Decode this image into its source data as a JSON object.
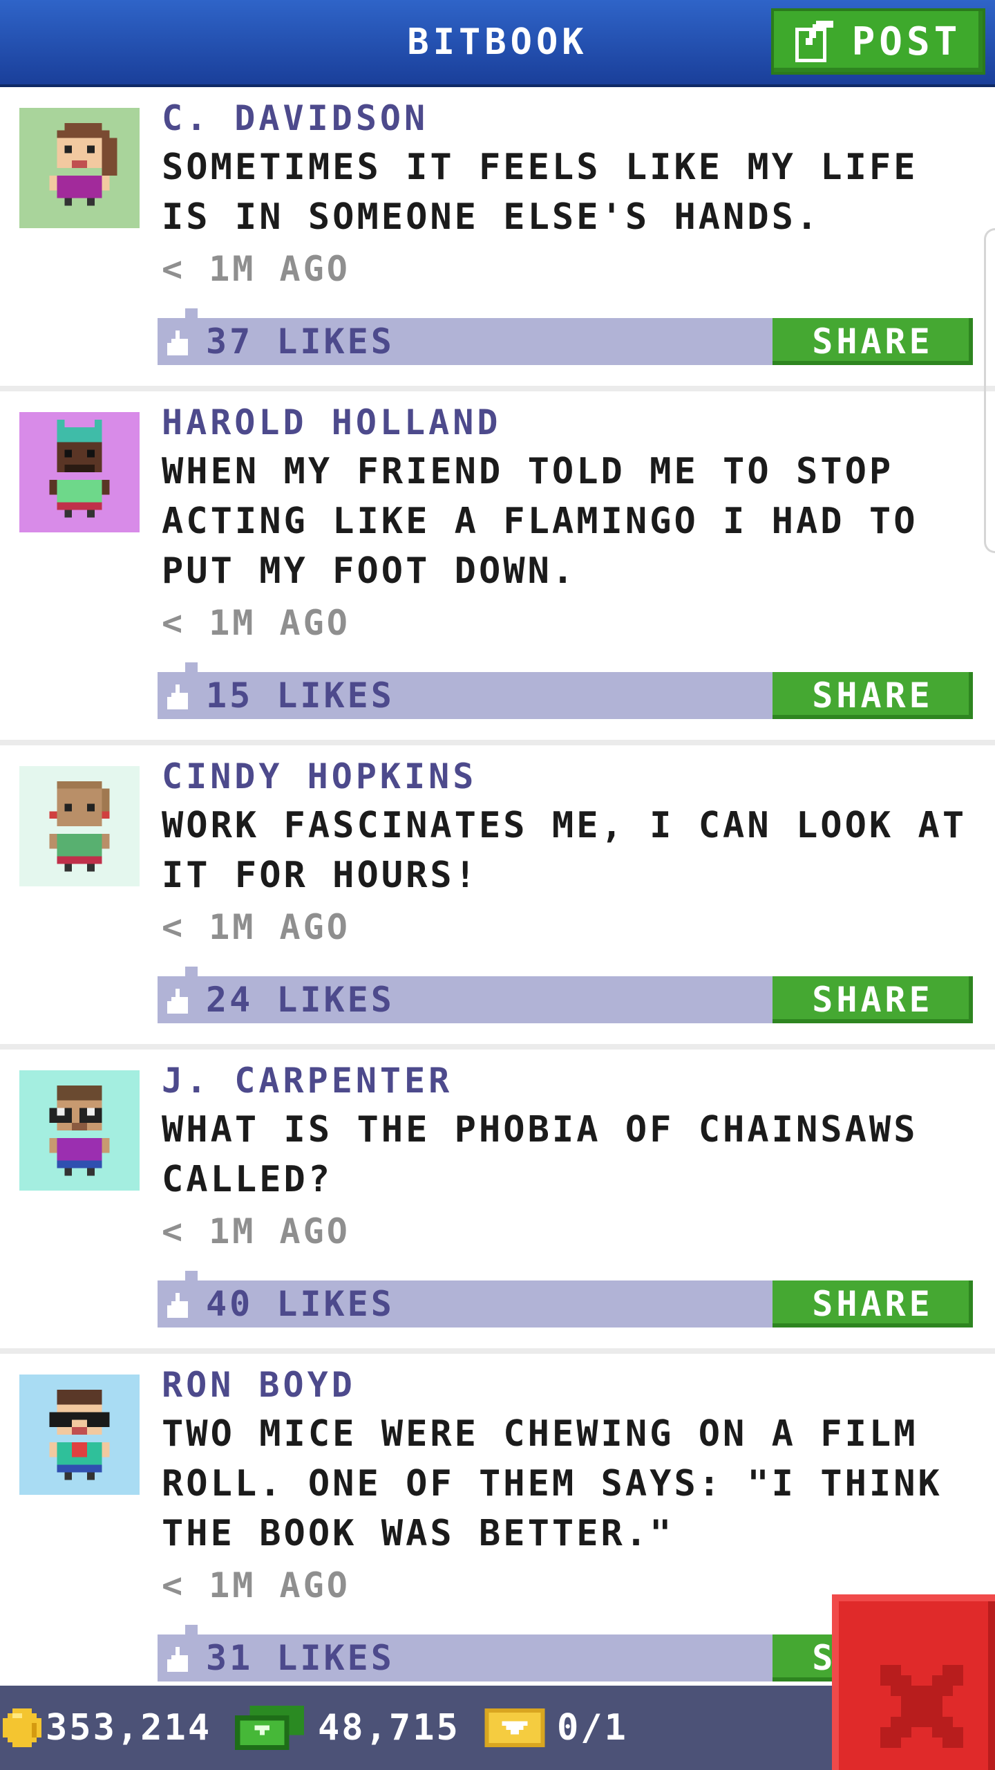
{
  "header": {
    "title": "BITBOOK",
    "post_label": "POST"
  },
  "posts": [
    {
      "author": "C. DAVIDSON",
      "text": "SOMETIMES IT FEELS LIKE MY LIFE IS IN SOMEONE ELSE'S HANDS.",
      "time": "< 1M AGO",
      "likes": "37 LIKES",
      "share": "SHARE",
      "avatar_bg": "#a9d49b"
    },
    {
      "author": "HAROLD HOLLAND",
      "text": "WHEN MY FRIEND TOLD ME TO STOP ACTING LIKE A FLAMINGO I HAD TO PUT MY FOOT DOWN.",
      "time": "< 1M AGO",
      "likes": "15 LIKES",
      "share": "SHARE",
      "avatar_bg": "#d88be8"
    },
    {
      "author": "CINDY HOPKINS",
      "text": "WORK FASCINATES ME, I CAN LOOK AT IT FOR HOURS!",
      "time": "< 1M AGO",
      "likes": "24 LIKES",
      "share": "SHARE",
      "avatar_bg": "#e4f7ee"
    },
    {
      "author": "J. CARPENTER",
      "text": "WHAT IS THE PHOBIA OF CHAINSAWS CALLED?",
      "time": "< 1M AGO",
      "likes": "40 LIKES",
      "share": "SHARE",
      "avatar_bg": "#a4eee0"
    },
    {
      "author": "RON BOYD",
      "text": "TWO MICE WERE CHEWING ON A FILM ROLL. ONE OF THEM SAYS: \"I THINK THE BOOK WAS BETTER.\"",
      "time": "< 1M AGO",
      "likes": "31 LIKES",
      "share": "SHARE",
      "avatar_bg": "#a9dcf3"
    }
  ],
  "status": {
    "coins": "353,214",
    "bux": "48,715",
    "tickets": "0/1"
  },
  "icons": {
    "post": "edit-icon",
    "like": "thumbs-up-icon",
    "coin": "coin-icon",
    "bux": "cash-icon",
    "ticket": "ticket-icon",
    "close": "close-icon"
  }
}
